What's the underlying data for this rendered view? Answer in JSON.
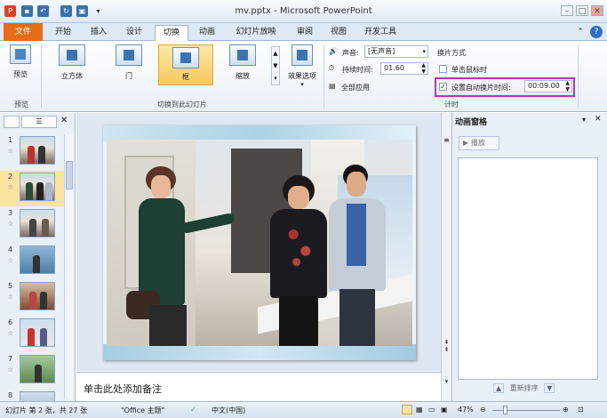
{
  "window": {
    "title": "mv.pptx - Microsoft PowerPoint"
  },
  "tabs": [
    "文件",
    "开始",
    "插入",
    "设计",
    "切换",
    "动画",
    "幻灯片放映",
    "审阅",
    "视图",
    "开发工具"
  ],
  "ribbon": {
    "preview_label": "预览",
    "preview_group": "预览",
    "transitions": [
      "立方体",
      "门",
      "框",
      "缩放"
    ],
    "effect_options": "效果选项",
    "transitions_group": "切换到此幻灯片",
    "sound_label": "声音:",
    "sound_value": "[无声音]",
    "duration_label": "持续时间:",
    "duration_value": "01.60",
    "apply_all": "全部应用",
    "advance_title": "换片方式",
    "on_click": "单击鼠标时",
    "after_time": "设置自动换片时间:",
    "after_value": "00:09.00",
    "timing_group": "计时"
  },
  "slides": [
    "1",
    "2",
    "3",
    "4",
    "5",
    "6",
    "7",
    "8"
  ],
  "notes_placeholder": "单击此处添加备注",
  "anim_pane": {
    "title": "动画窗格",
    "play": "播放",
    "reorder": "重新排序"
  },
  "status": {
    "slide_info": "幻灯片 第 2 张，共 27 张",
    "theme": "\"Office 主题\"",
    "language": "中文(中国)",
    "zoom": "47%"
  },
  "colors": {
    "file_tab": "#e46c1a",
    "selected_transition": "#f7c95d",
    "highlight_box": "#b03aa8"
  }
}
